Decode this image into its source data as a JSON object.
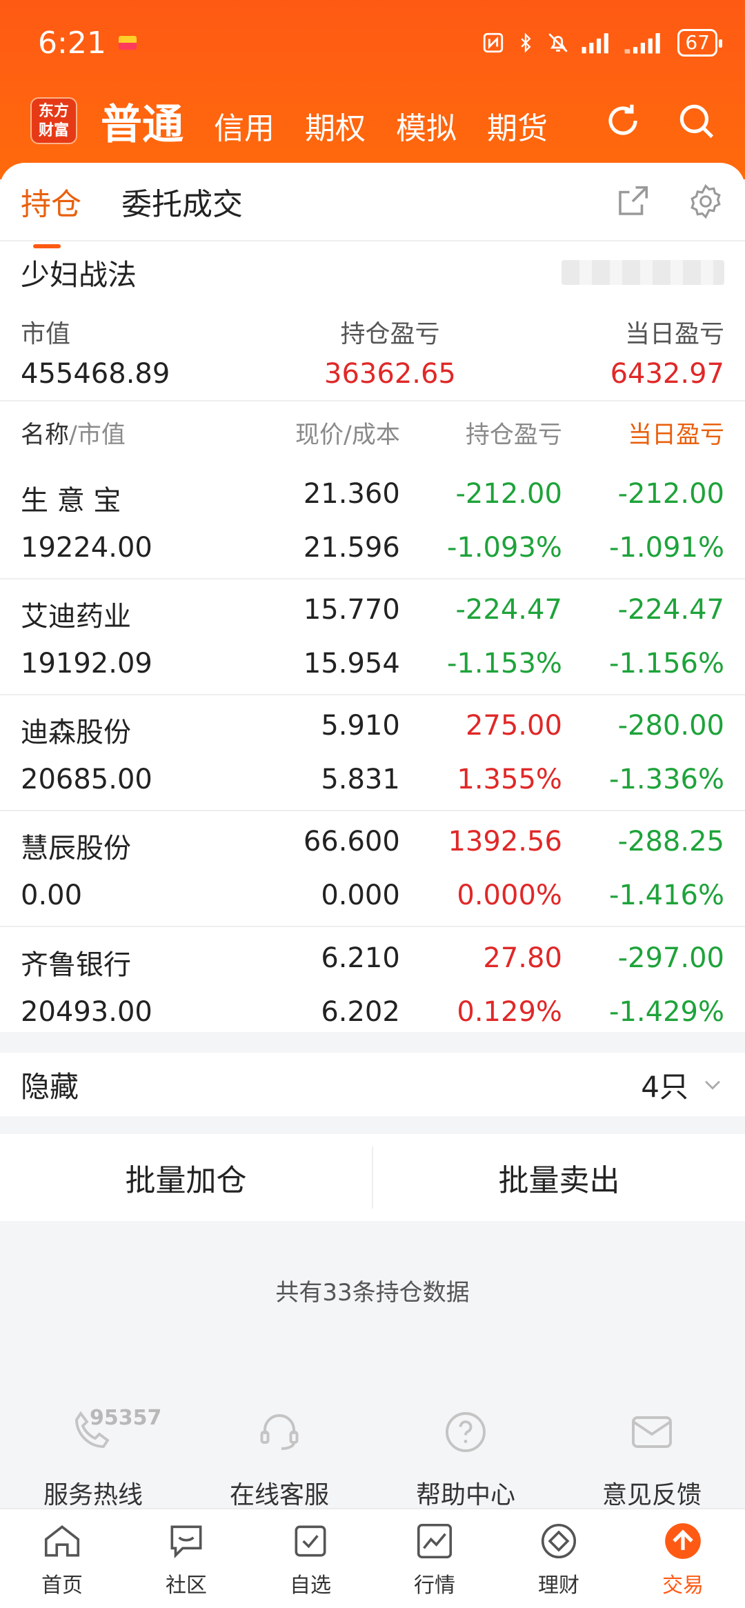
{
  "status": {
    "time": "6:21",
    "battery": "67"
  },
  "nav": {
    "logo": "东方财富",
    "active": "普通",
    "tabs": [
      "信用",
      "期权",
      "模拟",
      "期货"
    ]
  },
  "subtabs": [
    "持仓",
    "委托成交"
  ],
  "account": {
    "name": "少妇战法"
  },
  "summary": {
    "market_value_label": "市值",
    "market_value": "455468.89",
    "position_pl_label": "持仓盈亏",
    "position_pl": "36362.65",
    "today_pl_label": "当日盈亏",
    "today_pl": "6432.97"
  },
  "table": {
    "head": {
      "name": "名称",
      "sep": "/",
      "mv": "市值",
      "price": "现价/成本",
      "pl": "持仓盈亏",
      "today": "当日盈亏"
    },
    "rows": [
      {
        "name": "生 意 宝",
        "mv": "19224.00",
        "price": "21.360",
        "cost": "21.596",
        "pl": "-212.00",
        "plp": "-1.093%",
        "today": "-212.00",
        "todayp": "-1.091%"
      },
      {
        "name": "艾迪药业",
        "mv": "19192.09",
        "price": "15.770",
        "cost": "15.954",
        "pl": "-224.47",
        "plp": "-1.153%",
        "today": "-224.47",
        "todayp": "-1.156%"
      },
      {
        "name": "迪森股份",
        "mv": "20685.00",
        "price": "5.910",
        "cost": "5.831",
        "pl": "275.00",
        "plp": "1.355%",
        "today": "-280.00",
        "todayp": "-1.336%"
      },
      {
        "name": "慧辰股份",
        "mv": "0.00",
        "price": "66.600",
        "cost": "0.000",
        "pl": "1392.56",
        "plp": "0.000%",
        "today": "-288.25",
        "todayp": "-1.416%"
      },
      {
        "name": "齐鲁银行",
        "mv": "20493.00",
        "price": "6.210",
        "cost": "6.202",
        "pl": "27.80",
        "plp": "0.129%",
        "today": "-297.00",
        "todayp": "-1.429%"
      }
    ]
  },
  "hidden": {
    "label": "隐藏",
    "count": "4只"
  },
  "batch": {
    "add": "批量加仓",
    "sell": "批量卖出"
  },
  "count_note": "共有33条持仓数据",
  "services": [
    {
      "label": "服务热线",
      "number": "95357",
      "icon": "phone-icon"
    },
    {
      "label": "在线客服",
      "icon": "headset-icon"
    },
    {
      "label": "帮助中心",
      "icon": "help-icon"
    },
    {
      "label": "意见反馈",
      "icon": "mail-icon"
    }
  ],
  "tabbar": [
    "首页",
    "社区",
    "自选",
    "行情",
    "理财",
    "交易"
  ],
  "colors": {
    "accent": "#ff5a14",
    "up": "#e02828",
    "down": "#1ea33a"
  }
}
